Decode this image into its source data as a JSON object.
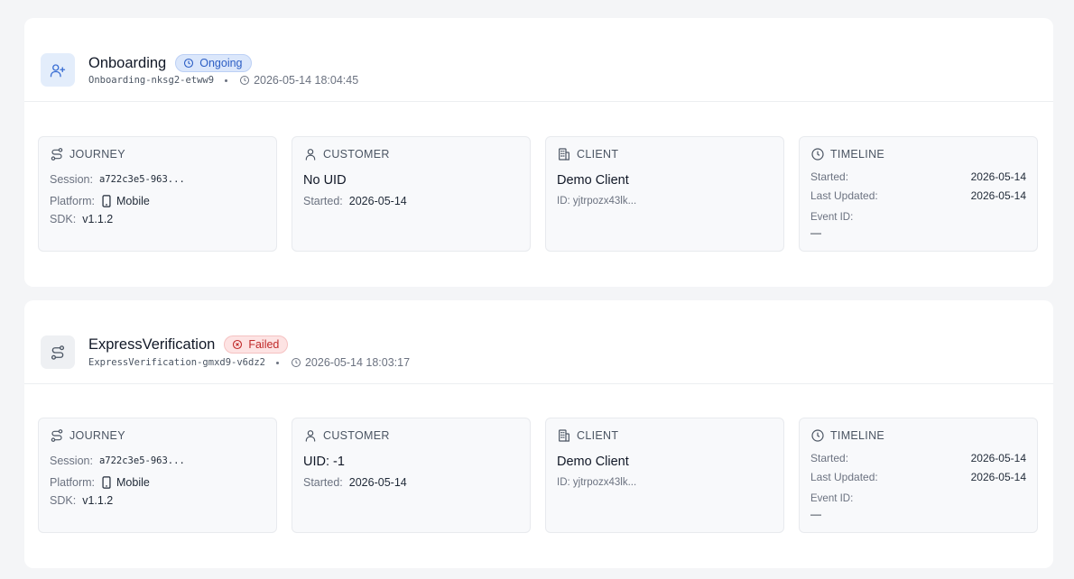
{
  "cards": [
    {
      "title": "Onboarding",
      "status": "Ongoing",
      "ref": "Onboarding-nksg2-etww9",
      "timestamp": "2026-05-14 18:04:45",
      "journey": {
        "heading": "JOURNEY",
        "session_label": "Session:",
        "session": "a722c3e5-963...",
        "platform_label": "Platform:",
        "platform": "Mobile",
        "sdk_label": "SDK:",
        "sdk": "v1.1.2"
      },
      "customer": {
        "heading": "CUSTOMER",
        "uid": "No UID",
        "started_label": "Started:",
        "started": "2026-05-14"
      },
      "client": {
        "heading": "CLIENT",
        "name": "Demo Client",
        "id": "ID: yjtrpozx43lk..."
      },
      "timeline": {
        "heading": "TIMELINE",
        "started_label": "Started:",
        "started": "2026-05-14",
        "updated_label": "Last Updated:",
        "updated": "2026-05-14",
        "event_label": "Event ID:",
        "event": "—"
      }
    },
    {
      "title": "ExpressVerification",
      "status": "Failed",
      "ref": "ExpressVerification-gmxd9-v6dz2",
      "timestamp": "2026-05-14 18:03:17",
      "journey": {
        "heading": "JOURNEY",
        "session_label": "Session:",
        "session": "a722c3e5-963...",
        "platform_label": "Platform:",
        "platform": "Mobile",
        "sdk_label": "SDK:",
        "sdk": "v1.1.2"
      },
      "customer": {
        "heading": "CUSTOMER",
        "uid": "UID: -1",
        "started_label": "Started:",
        "started": "2026-05-14"
      },
      "client": {
        "heading": "CLIENT",
        "name": "Demo Client",
        "id": "ID: yjtrpozx43lk..."
      },
      "timeline": {
        "heading": "TIMELINE",
        "started_label": "Started:",
        "started": "2026-05-14",
        "updated_label": "Last Updated:",
        "updated": "2026-05-14",
        "event_label": "Event ID:",
        "event": "—"
      }
    }
  ],
  "icons": {
    "card0": "user-plus-icon",
    "card1": "route-icon",
    "journey": "route-icon",
    "customer": "user-icon",
    "client": "building-icon",
    "timeline": "clock-icon",
    "platform": "smartphone-icon"
  },
  "colors": {
    "ongoing": "#2c5ec4",
    "failed": "#c02a2a"
  }
}
